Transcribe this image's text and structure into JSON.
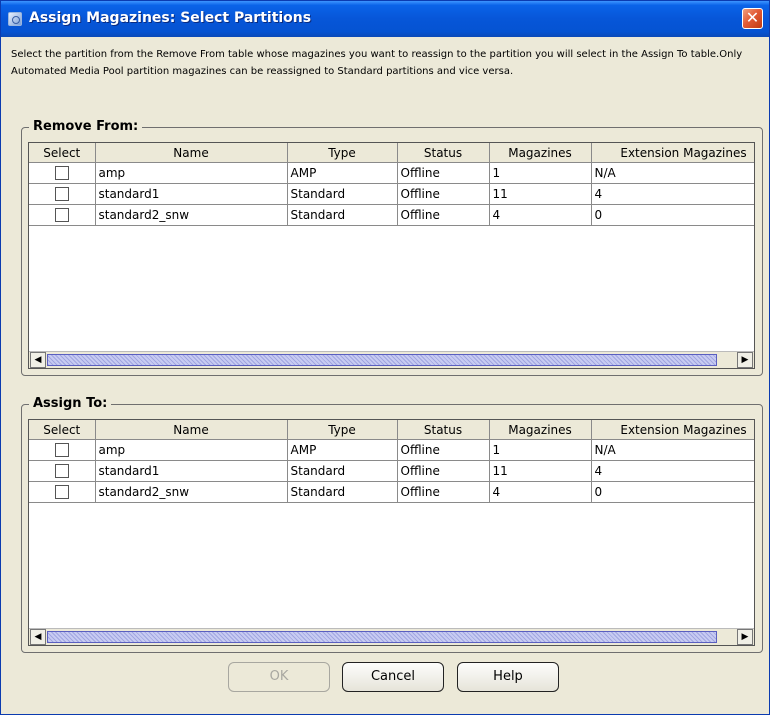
{
  "window": {
    "title": "Assign Magazines: Select Partitions",
    "close_symbol": "✕"
  },
  "instructions": "Select the partition from the Remove From table whose magazines you want to reassign to the partition you will select in the Assign To table.Only Automated Media Pool partition magazines can be reassigned to Standard partitions and vice versa.",
  "columns": [
    "Select",
    "Name",
    "Type",
    "Status",
    "Magazines",
    "Extension Magazines"
  ],
  "remove_from": {
    "title": "Remove From:",
    "rows": [
      {
        "selected": false,
        "name": "amp",
        "type": "AMP",
        "status": "Offline",
        "magazines": "1",
        "extension_magazines": "N/A"
      },
      {
        "selected": false,
        "name": "standard1",
        "type": "Standard",
        "status": "Offline",
        "magazines": "11",
        "extension_magazines": "4"
      },
      {
        "selected": false,
        "name": "standard2_snw",
        "type": "Standard",
        "status": "Offline",
        "magazines": "4",
        "extension_magazines": "0"
      }
    ]
  },
  "assign_to": {
    "title": "Assign To:",
    "rows": [
      {
        "selected": false,
        "name": "amp",
        "type": "AMP",
        "status": "Offline",
        "magazines": "1",
        "extension_magazines": "N/A"
      },
      {
        "selected": false,
        "name": "standard1",
        "type": "Standard",
        "status": "Offline",
        "magazines": "11",
        "extension_magazines": "4"
      },
      {
        "selected": false,
        "name": "standard2_snw",
        "type": "Standard",
        "status": "Offline",
        "magazines": "4",
        "extension_magazines": "0"
      }
    ]
  },
  "scrollbar": {
    "left_arrow": "◀",
    "right_arrow": "▶"
  },
  "buttons": {
    "ok": "OK",
    "cancel": "Cancel",
    "help": "Help",
    "ok_enabled": false
  },
  "colors": {
    "titlebar": "#0756d8",
    "close_button": "#e25b36",
    "dialog_background": "#ece9d8",
    "scroll_thumb": "#c7cbf2"
  }
}
